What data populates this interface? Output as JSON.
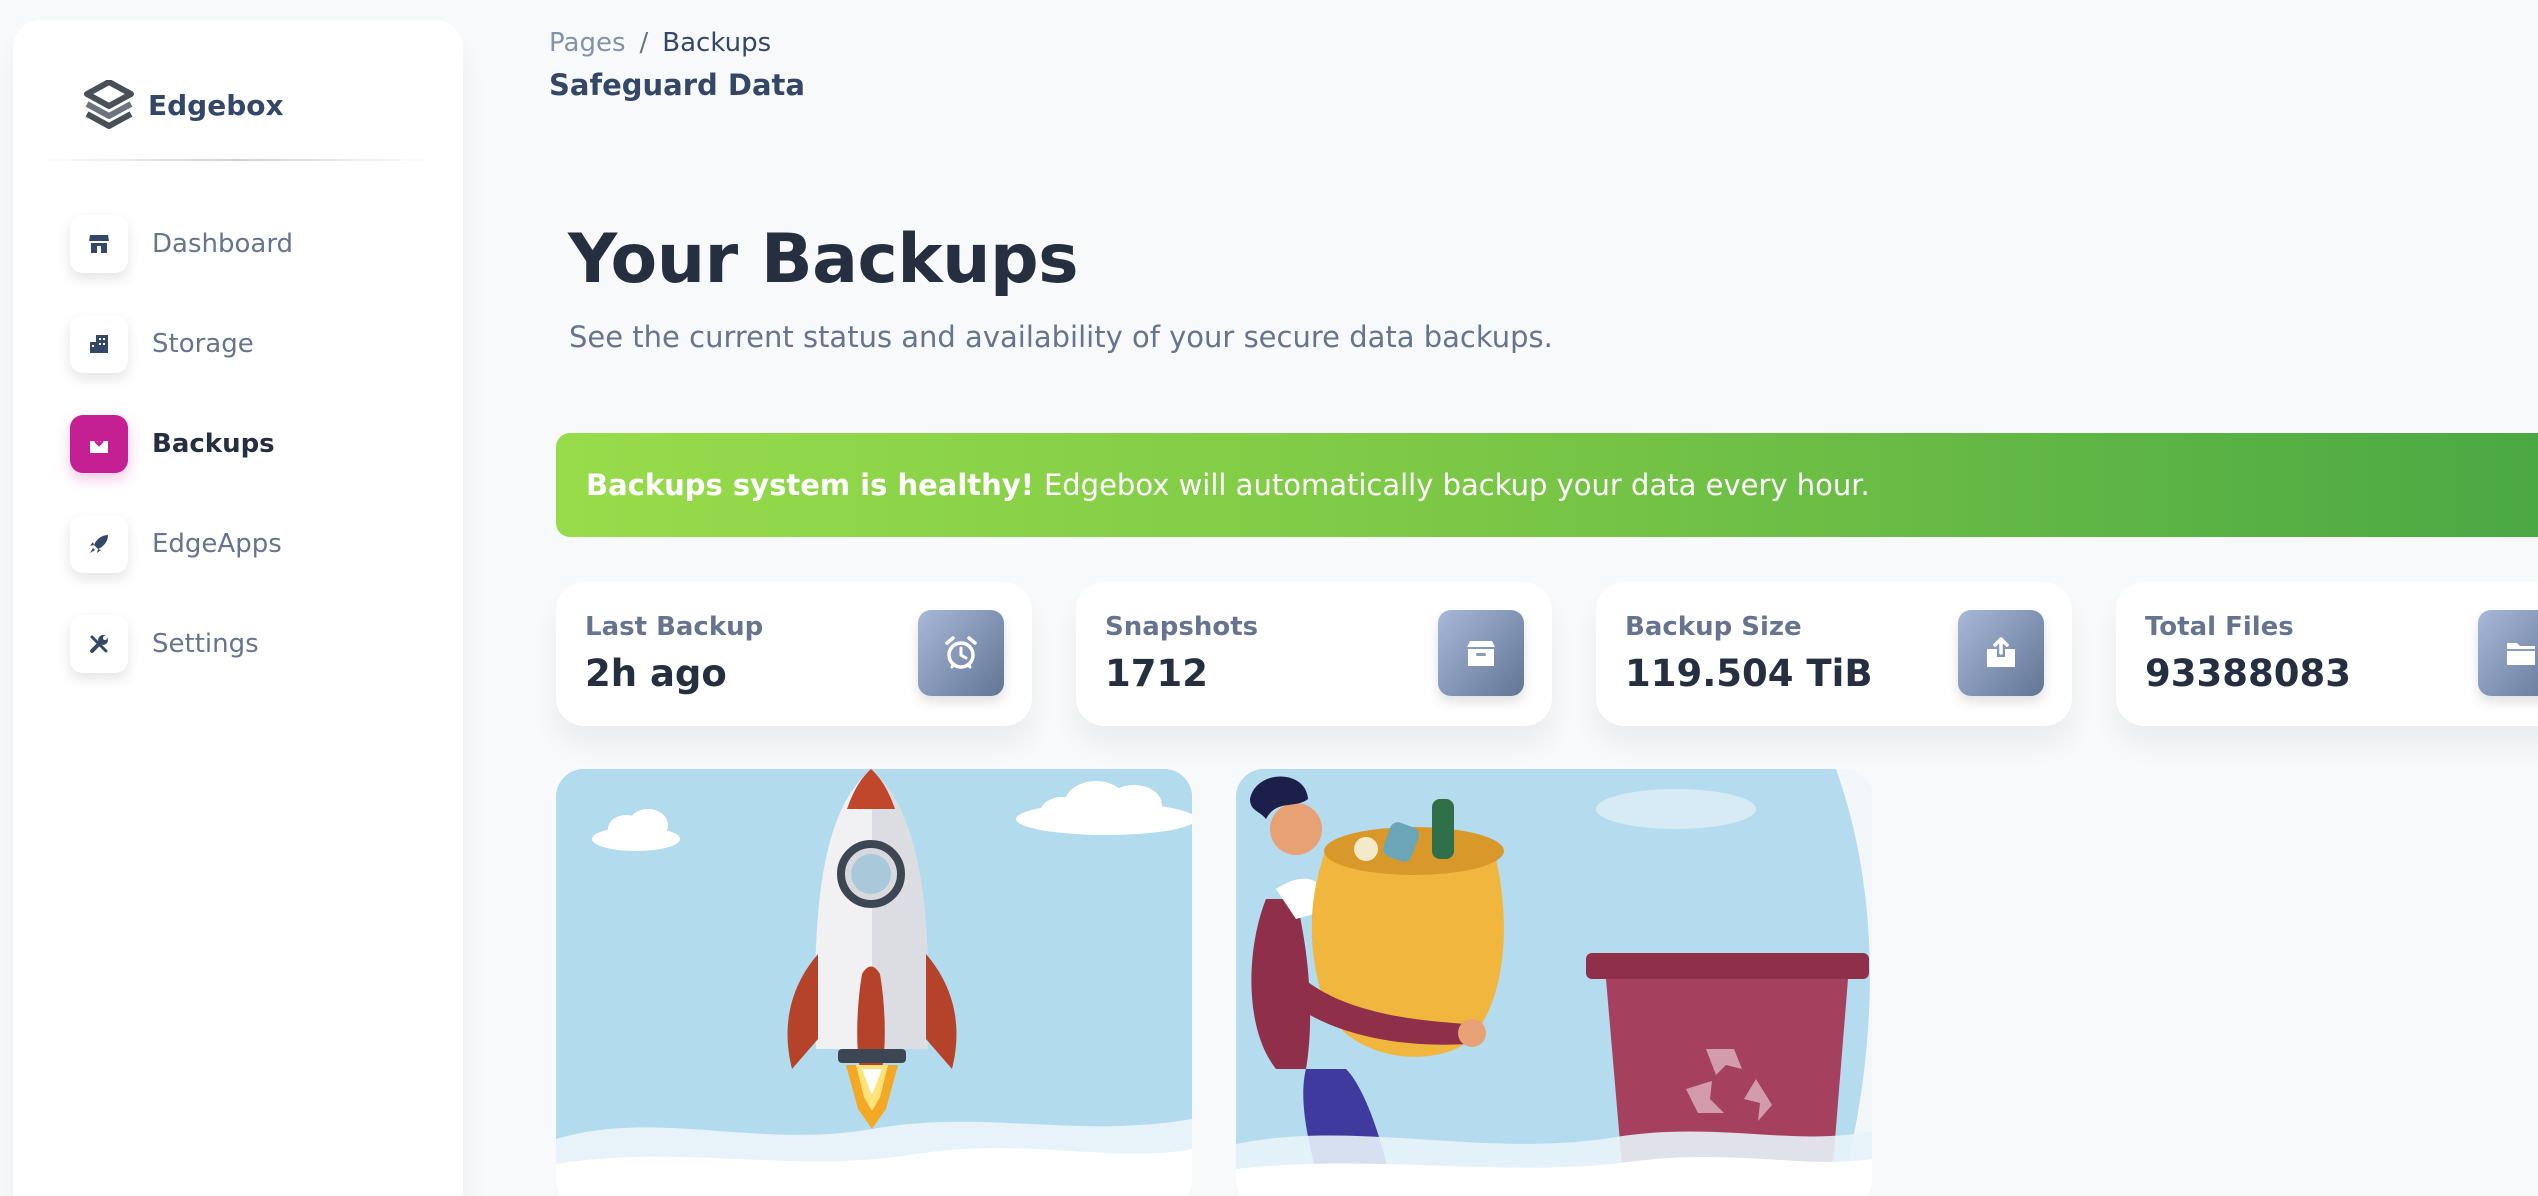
{
  "brand": {
    "name": "Edgebox",
    "logo_icon": "edgebox-logo-icon"
  },
  "sidebar": {
    "items": [
      {
        "label": "Dashboard",
        "icon": "shop-icon",
        "active": false
      },
      {
        "label": "Storage",
        "icon": "office-building-icon",
        "active": false
      },
      {
        "label": "Backups",
        "icon": "box-icon",
        "active": true
      },
      {
        "label": "EdgeApps",
        "icon": "rocket-icon",
        "active": false
      },
      {
        "label": "Settings",
        "icon": "tools-icon",
        "active": false
      }
    ]
  },
  "header": {
    "breadcrumb_parent": "Pages",
    "breadcrumb_separator": "/",
    "breadcrumb_current": "Backups",
    "page_title": "Safeguard Data"
  },
  "hero": {
    "title": "Your Backups",
    "subtitle": "See the current status and availability of your secure data backups."
  },
  "alert": {
    "bold": "Backups system is healthy!",
    "text": "Edgebox will automatically backup your data every hour.",
    "color": "#7cc846"
  },
  "stats": [
    {
      "label": "Last Backup",
      "value": "2h ago",
      "icon": "alarm-clock-icon"
    },
    {
      "label": "Snapshots",
      "value": "1712",
      "icon": "archive-icon"
    },
    {
      "label": "Backup Size",
      "value": "119.504 TiB",
      "icon": "box-open-icon"
    },
    {
      "label": "Total Files",
      "value": "93388083",
      "icon": "folder-icon"
    }
  ],
  "illustrations": [
    {
      "name": "rocket-illustration"
    },
    {
      "name": "recycle-illustration"
    }
  ],
  "colors": {
    "accent": "#c41f93",
    "icon_gradient": "#8392ab",
    "text_dark": "#252f40",
    "text_muted": "#67748e"
  }
}
